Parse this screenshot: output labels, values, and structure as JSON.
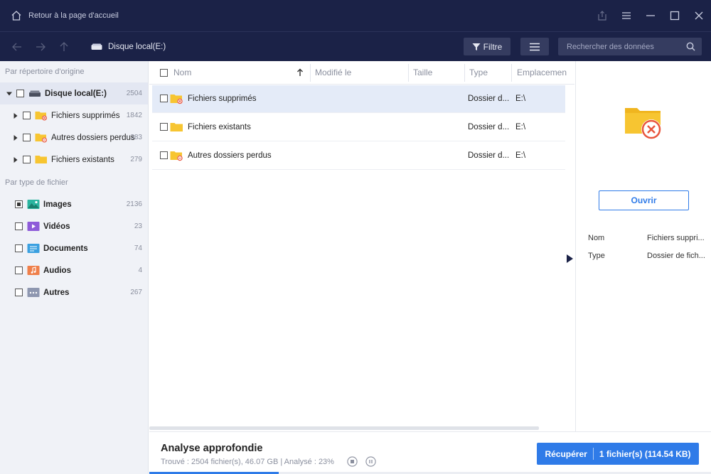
{
  "titlebar": {
    "home_label": "Retour à la page d'accueil"
  },
  "toolbar": {
    "breadcrumb": "Disque local(E:)",
    "filter_label": "Filtre",
    "search_placeholder": "Rechercher des données"
  },
  "sidebar": {
    "section_origin": "Par répertoire d'origine",
    "tree": [
      {
        "label": "Disque local(E:)",
        "count": "2504"
      },
      {
        "label": "Fichiers supprimés",
        "count": "1842"
      },
      {
        "label": "Autres dossiers perdus",
        "count": "383"
      },
      {
        "label": "Fichiers existants",
        "count": "279"
      }
    ],
    "section_type": "Par type de fichier",
    "types": [
      {
        "label": "Images",
        "count": "2136"
      },
      {
        "label": "Vidéos",
        "count": "23"
      },
      {
        "label": "Documents",
        "count": "74"
      },
      {
        "label": "Audios",
        "count": "4"
      },
      {
        "label": "Autres",
        "count": "267"
      }
    ]
  },
  "table": {
    "columns": [
      "Nom",
      "Modifié le",
      "Taille",
      "Type",
      "Emplacement"
    ],
    "rows": [
      {
        "name": "Fichiers supprimés",
        "type": "Dossier d...",
        "location": "E:\\"
      },
      {
        "name": "Fichiers existants",
        "type": "Dossier d...",
        "location": "E:\\"
      },
      {
        "name": "Autres dossiers perdus",
        "type": "Dossier d...",
        "location": "E:\\"
      }
    ]
  },
  "preview": {
    "open_label": "Ouvrir",
    "props": [
      {
        "key": "Nom",
        "value": "Fichiers suppri..."
      },
      {
        "key": "Type",
        "value": "Dossier de fich..."
      }
    ]
  },
  "bottom": {
    "scan_title": "Analyse approfondie",
    "scan_stats": "Trouvé : 2504 fichier(s), 46.07 GB | Analysé : 23%",
    "progress": 0.23,
    "recover_label": "Récupérer",
    "recover_detail": "1 fichier(s) (114.54 KB)"
  },
  "colors": {
    "titlebar_bg": "#1b2247",
    "accent": "#2f7be8",
    "folder_yellow": "#f7c531",
    "delete_red": "#e8553e"
  }
}
